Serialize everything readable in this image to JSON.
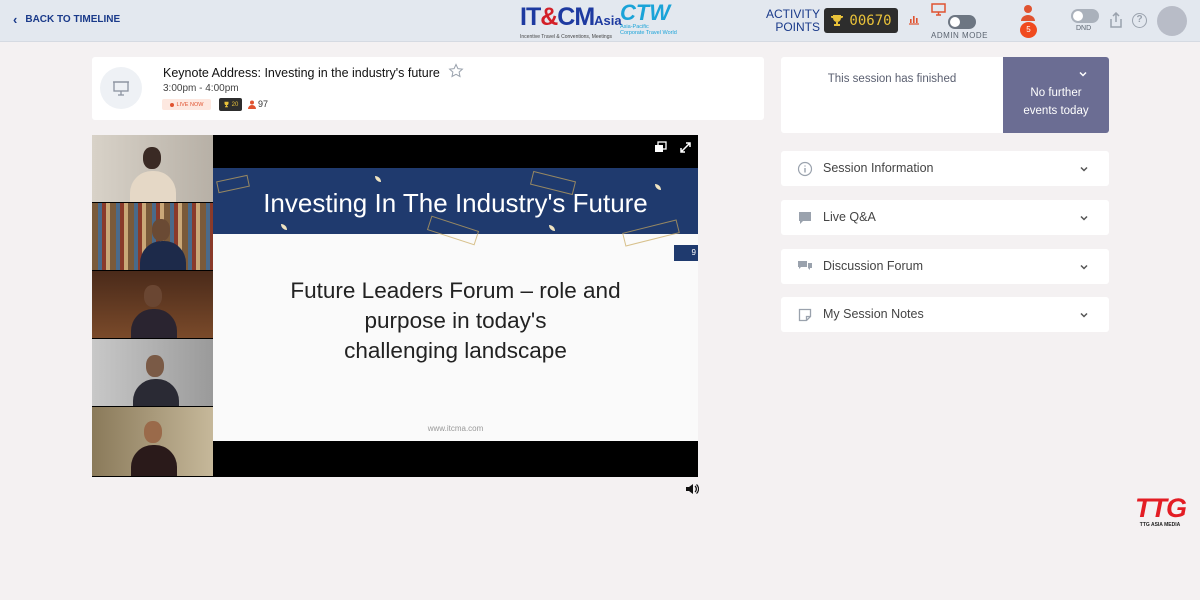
{
  "header": {
    "back_label": "BACK TO TIMELINE",
    "logo_itcm": {
      "text_a": "IT",
      "text_b": "&",
      "text_c": "CM",
      "text_d": "Asia",
      "tagline": "Incentive Travel & Conventions, Meetings"
    },
    "logo_ctw": {
      "text": "CTW",
      "tagline_1": "Asia-Pacific",
      "tagline_2": "Corporate Travel World"
    },
    "activity_label_1": "ACTIVITY",
    "activity_label_2": "POINTS",
    "points": "00670",
    "admin_label": "ADMIN MODE",
    "notification_count": "5",
    "dnd_label": "DND",
    "help_glyph": "?"
  },
  "session": {
    "title": "Keynote Address: Investing in the industry's future",
    "time": "3:00pm - 4:00pm",
    "live_label": "LIVE NOW",
    "trophy_points": "20",
    "attendees": "97"
  },
  "slide": {
    "heading": "Investing In The Industry's Future",
    "page_number": "9",
    "body_line_1": "Future Leaders Forum – role and",
    "body_line_2": "purpose in today's",
    "body_line_3": "challenging landscape",
    "url": "www.itcma.com"
  },
  "right_panel": {
    "finished_message": "This session has finished",
    "next_line_1": "No further",
    "next_line_2": "events today",
    "sections": [
      {
        "label": "Session Information",
        "icon": "info-icon"
      },
      {
        "label": "Live Q&A",
        "icon": "chat-bubble-icon"
      },
      {
        "label": "Discussion Forum",
        "icon": "forum-icon"
      },
      {
        "label": "My Session Notes",
        "icon": "notes-icon"
      }
    ]
  },
  "footer_logo": {
    "text": "TTG",
    "tagline": "TTG ASIA MEDIA"
  },
  "colors": {
    "header_bg": "#e3e8ef",
    "accent_navy": "#1a3a8a",
    "next_event_bg": "#6b6d93",
    "live_red": "#e05330",
    "points_gold": "#e9c23a"
  }
}
